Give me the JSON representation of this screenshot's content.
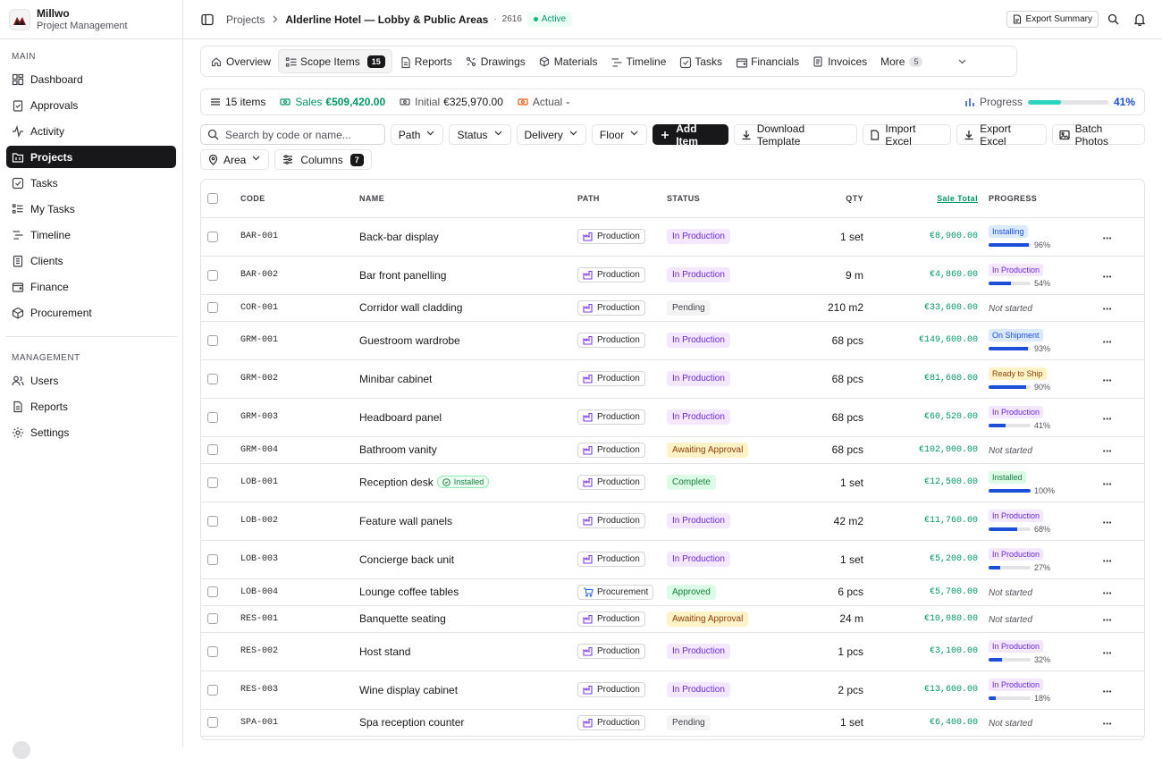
{
  "app": {
    "name": "Millwo",
    "subtitle": "Project Management"
  },
  "sidebar": {
    "main_label": "MAIN",
    "main_items": [
      {
        "label": "Dashboard",
        "icon": "dashboard-icon"
      },
      {
        "label": "Approvals",
        "icon": "clipboard-check-icon"
      },
      {
        "label": "Activity",
        "icon": "activity-icon"
      },
      {
        "label": "Projects",
        "icon": "folder-icon",
        "active": true
      },
      {
        "label": "Tasks",
        "icon": "checkbox-icon"
      },
      {
        "label": "My Tasks",
        "icon": "list-icon"
      },
      {
        "label": "Timeline",
        "icon": "timeline-icon"
      },
      {
        "label": "Clients",
        "icon": "building-icon"
      },
      {
        "label": "Finance",
        "icon": "wallet-icon"
      },
      {
        "label": "Procurement",
        "icon": "package-icon"
      }
    ],
    "management_label": "MANAGEMENT",
    "management_items": [
      {
        "label": "Users",
        "icon": "users-icon"
      },
      {
        "label": "Reports",
        "icon": "file-icon"
      },
      {
        "label": "Settings",
        "icon": "gear-icon"
      }
    ]
  },
  "header": {
    "crumb_root": "Projects",
    "project_title": "Alderline Hotel — Lobby & Public Areas",
    "project_number": "2616",
    "status": "Active",
    "export_label": "Export Summary"
  },
  "tabs": [
    {
      "label": "Overview",
      "icon": "home-icon"
    },
    {
      "label": "Scope Items",
      "icon": "list-icon",
      "badge": "15",
      "active": true
    },
    {
      "label": "Reports",
      "icon": "file-icon"
    },
    {
      "label": "Drawings",
      "icon": "drawing-icon"
    },
    {
      "label": "Materials",
      "icon": "cube-icon"
    },
    {
      "label": "Timeline",
      "icon": "timeline-icon"
    },
    {
      "label": "Tasks",
      "icon": "checkbox-icon"
    },
    {
      "label": "Financials",
      "icon": "wallet-icon"
    },
    {
      "label": "Invoices",
      "icon": "invoice-icon"
    }
  ],
  "more_tab": {
    "label": "More",
    "badge": "5"
  },
  "summary": {
    "items_label": "15 items",
    "sales_label": "Sales",
    "sales_value": "€509,420.00",
    "initial_label": "Initial",
    "initial_value": "€325,970.00",
    "actual_label": "Actual",
    "actual_value": "-",
    "progress_label": "Progress",
    "progress_value": "41%",
    "progress_fraction": 0.41
  },
  "toolbar": {
    "search_placeholder": "Search by code or name...",
    "filters": [
      "Path",
      "Status",
      "Delivery",
      "Floor"
    ],
    "add_item": "Add Item",
    "download_template": "Download Template",
    "import_excel": "Import Excel",
    "export_excel": "Export Excel",
    "batch_photos": "Batch Photos",
    "area": "Area",
    "columns": "Columns",
    "columns_count": "7"
  },
  "table": {
    "headers": {
      "code": "CODE",
      "name": "NAME",
      "path": "PATH",
      "status": "STATUS",
      "qty": "QTY",
      "sale_total": "Sale Total",
      "progress": "PROGRESS"
    },
    "rows": [
      {
        "code": "BAR-001",
        "name": "Back-bar display",
        "path": "Production",
        "status": "In Production",
        "qty": "1 set",
        "sale": "€8,900.00",
        "pstage": "Installing",
        "pct": "96%",
        "pval": 0.96
      },
      {
        "code": "BAR-002",
        "name": "Bar front panelling",
        "path": "Production",
        "status": "In Production",
        "qty": "9 m",
        "sale": "€4,860.00",
        "pstage": "In Production",
        "pct": "54%",
        "pval": 0.54
      },
      {
        "code": "COR-001",
        "name": "Corridor wall cladding",
        "path": "Production",
        "status": "Pending",
        "qty": "210 m2",
        "sale": "€33,600.00",
        "notstarted": "Not started"
      },
      {
        "code": "GRM-001",
        "name": "Guestroom wardrobe",
        "path": "Production",
        "status": "In Production",
        "qty": "68 pcs",
        "sale": "€149,600.00",
        "pstage": "On Shipment",
        "pct": "93%",
        "pval": 0.93
      },
      {
        "code": "GRM-002",
        "name": "Minibar cabinet",
        "path": "Production",
        "status": "In Production",
        "qty": "68 pcs",
        "sale": "€81,600.00",
        "pstage": "Ready to Ship",
        "pct": "90%",
        "pval": 0.9
      },
      {
        "code": "GRM-003",
        "name": "Headboard panel",
        "path": "Production",
        "status": "In Production",
        "qty": "68 pcs",
        "sale": "€60,520.00",
        "pstage": "In Production",
        "pct": "41%",
        "pval": 0.41
      },
      {
        "code": "GRM-004",
        "name": "Bathroom vanity",
        "path": "Production",
        "status": "Awaiting Approval",
        "qty": "68 pcs",
        "sale": "€102,000.00",
        "notstarted": "Not started"
      },
      {
        "code": "LOB-001",
        "name": "Reception desk",
        "tag": "Installed",
        "path": "Production",
        "status": "Complete",
        "qty": "1 set",
        "sale": "€12,500.00",
        "pstage": "Installed",
        "pct": "100%",
        "pval": 1.0
      },
      {
        "code": "LOB-002",
        "name": "Feature wall panels",
        "path": "Production",
        "status": "In Production",
        "qty": "42 m2",
        "sale": "€11,760.00",
        "pstage": "In Production",
        "pct": "68%",
        "pval": 0.68
      },
      {
        "code": "LOB-003",
        "name": "Concierge back unit",
        "path": "Production",
        "status": "In Production",
        "qty": "1 set",
        "sale": "€5,200.00",
        "pstage": "In Production",
        "pct": "27%",
        "pval": 0.27
      },
      {
        "code": "LOB-004",
        "name": "Lounge coffee tables",
        "path": "Procurement",
        "status": "Approved",
        "qty": "6 pcs",
        "sale": "€5,700.00",
        "notstarted": "Not started"
      },
      {
        "code": "RES-001",
        "name": "Banquette seating",
        "path": "Production",
        "status": "Awaiting Approval",
        "qty": "24 m",
        "sale": "€10,080.00",
        "notstarted": "Not started"
      },
      {
        "code": "RES-002",
        "name": "Host stand",
        "path": "Production",
        "status": "In Production",
        "qty": "1 pcs",
        "sale": "€3,100.00",
        "pstage": "In Production",
        "pct": "32%",
        "pval": 0.32
      },
      {
        "code": "RES-003",
        "name": "Wine display cabinet",
        "path": "Production",
        "status": "In Production",
        "qty": "2 pcs",
        "sale": "€13,600.00",
        "pstage": "In Production",
        "pct": "18%",
        "pval": 0.18
      },
      {
        "code": "SPA-001",
        "name": "Spa reception counter",
        "path": "Production",
        "status": "Pending",
        "qty": "1 set",
        "sale": "€6,400.00",
        "notstarted": "Not started"
      }
    ]
  }
}
